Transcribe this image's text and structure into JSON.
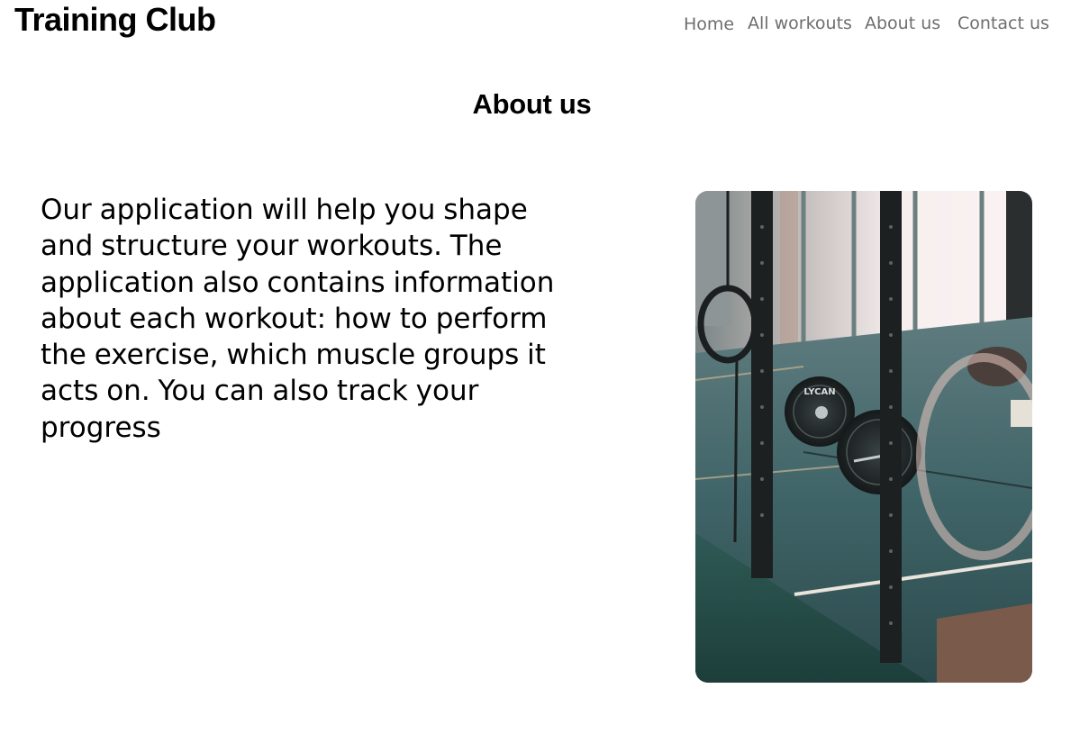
{
  "header": {
    "logo": "Training Club",
    "nav": [
      {
        "label": "Home"
      },
      {
        "label": "All workouts"
      },
      {
        "label": "About us"
      },
      {
        "label": "Contact us"
      }
    ]
  },
  "main": {
    "title": "About us",
    "description": "Our application will help you shape and structure your workouts. The application also contains information about each workout: how to perform the exercise, which muscle groups it acts on. You can also track your progress",
    "image": {
      "subject": "gym interior with barbell plates and rack posts",
      "plate_text": "LYCAN"
    }
  }
}
